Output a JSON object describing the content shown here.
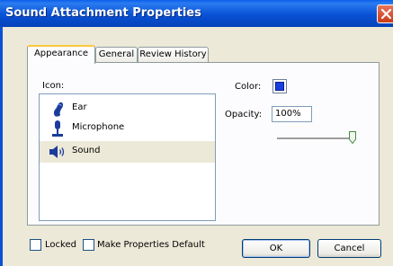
{
  "window": {
    "title": "Sound Attachment Properties"
  },
  "tabs": [
    {
      "label": "Appearance",
      "active": true
    },
    {
      "label": "General",
      "active": false
    },
    {
      "label": "Review History",
      "active": false
    }
  ],
  "icon_section": {
    "label": "Icon:",
    "items": [
      {
        "label": "Ear",
        "icon": "ear-icon",
        "selected": false
      },
      {
        "label": "Microphone",
        "icon": "microphone-icon",
        "selected": false
      },
      {
        "label": "Sound",
        "icon": "speaker-icon",
        "selected": true
      }
    ]
  },
  "color": {
    "label": "Color:",
    "value": "#1A3FE0"
  },
  "opacity": {
    "label": "Opacity:",
    "value": "100%",
    "level": 1.0
  },
  "footer": {
    "locked_label": "Locked",
    "locked_checked": false,
    "default_label": "Make Properties Default",
    "default_checked": false,
    "ok_label": "OK",
    "cancel_label": "Cancel"
  }
}
